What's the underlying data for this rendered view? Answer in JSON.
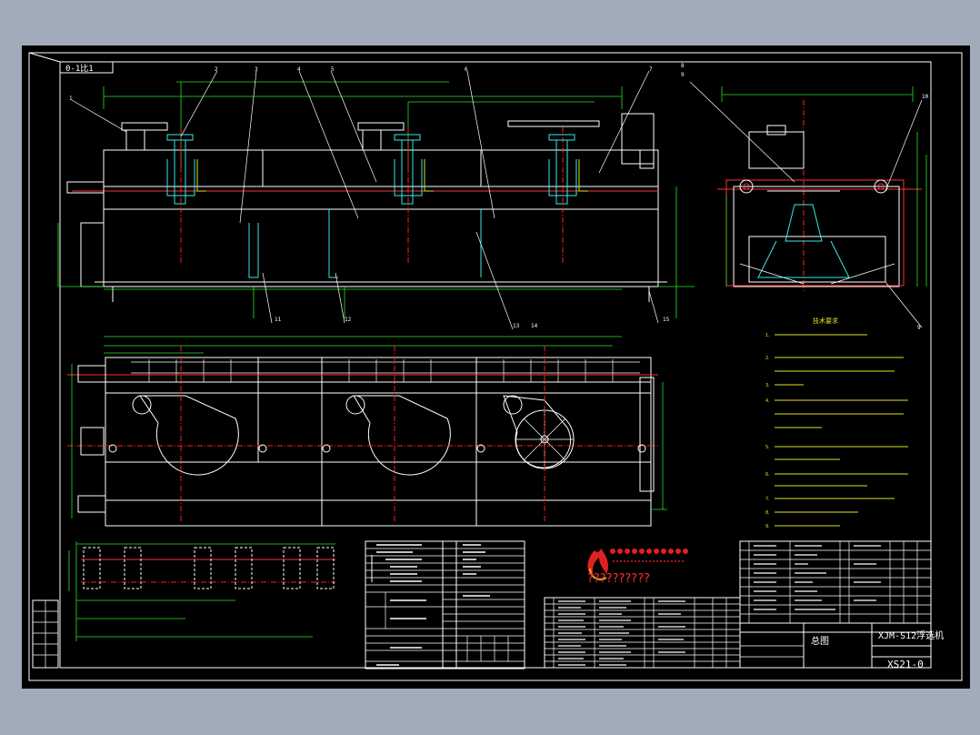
{
  "drawing": {
    "view_label": "0-1比1",
    "product_name": "XJM-S12浮选机",
    "drawing_no": "XS21-0",
    "sheet_title": "总图"
  },
  "colors": {
    "background": "#000000",
    "frame": "#ffffff",
    "centerline": "#ff2020",
    "dimension": "#28e028",
    "detail": "#38e8e8",
    "annotation": "#e0e020",
    "canvas_margin": "#a1abb9"
  },
  "callouts_top": [
    "1",
    "2",
    "3",
    "4",
    "5",
    "6",
    "7"
  ],
  "callouts_bottom": [
    "11",
    "12",
    "13",
    "14",
    "15"
  ],
  "callouts_side": [
    "8",
    "9",
    "10"
  ],
  "tech_requirements": {
    "title": "技术要求",
    "lines": [
      "1.",
      "2.",
      "3.",
      "4.",
      "5.",
      "6.",
      "7.",
      "8.",
      "9."
    ]
  },
  "watermark": {
    "text": "??????????"
  }
}
